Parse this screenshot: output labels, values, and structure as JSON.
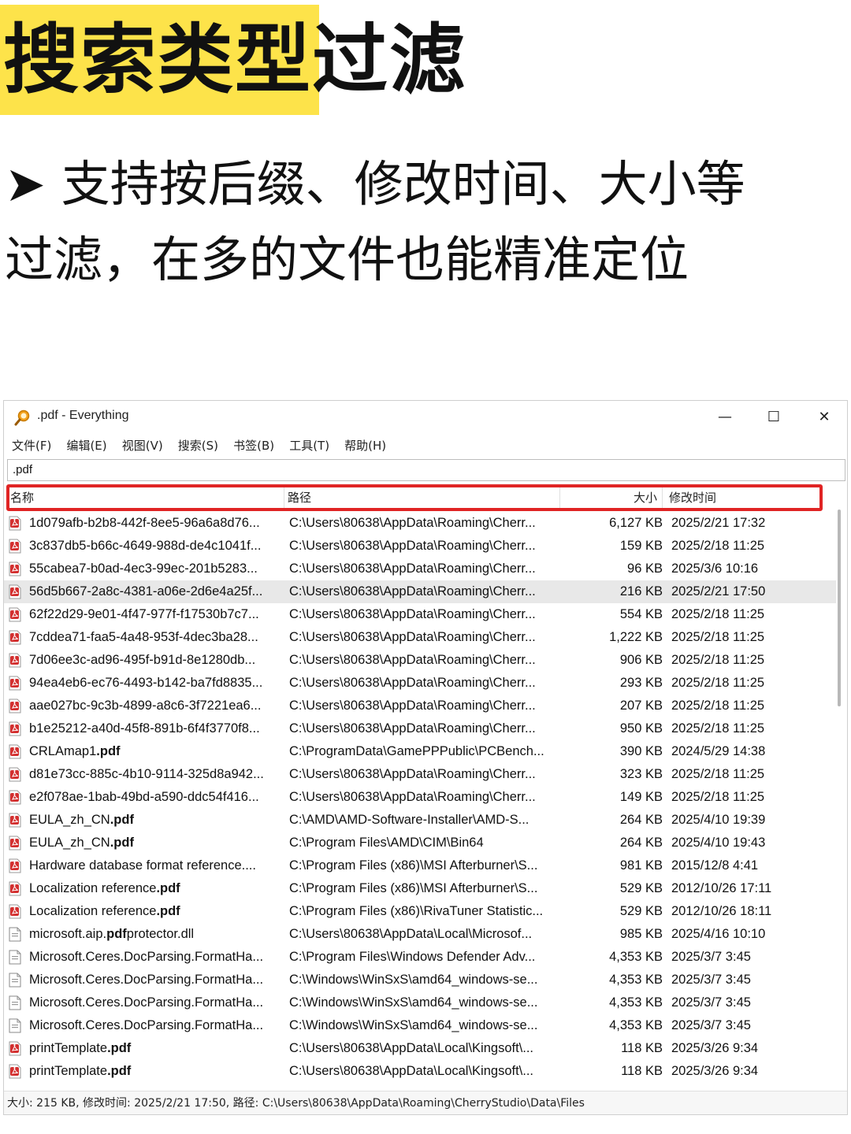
{
  "headline": "搜索类型过滤",
  "subtitle": {
    "bullet": "➤",
    "line1": "支持按后缀、修改时间、大小等",
    "line2": "过滤，在多的文件也能精准定位"
  },
  "colors": {
    "highlight": "#fde34a",
    "red_frame": "#e02424",
    "pdf_icon": "#d32f2f"
  },
  "window": {
    "title": ".pdf - Everything",
    "app_icon": "magnifier-icon",
    "controls": {
      "minimize": "—",
      "maximize": "☐",
      "close": "✕"
    },
    "menu": [
      "文件(F)",
      "编辑(E)",
      "视图(V)",
      "搜索(S)",
      "书签(B)",
      "工具(T)",
      "帮助(H)"
    ],
    "search_value": ".pdf",
    "columns": {
      "name": "名称",
      "path": "路径",
      "size": "大小",
      "modified": "修改时间"
    },
    "rows": [
      {
        "icon": "pdf",
        "name": "1d079afb-b2b8-442f-8ee5-96a6a8d76...",
        "path": "C:\\Users\\80638\\AppData\\Roaming\\Cherr...",
        "size": "6,127 KB",
        "modified": "2025/2/21 17:32"
      },
      {
        "icon": "pdf",
        "name": "3c837db5-b66c-4649-988d-de4c1041f...",
        "path": "C:\\Users\\80638\\AppData\\Roaming\\Cherr...",
        "size": "159 KB",
        "modified": "2025/2/18 11:25"
      },
      {
        "icon": "pdf",
        "name": "55cabea7-b0ad-4ec3-99ec-201b5283...",
        "path": "C:\\Users\\80638\\AppData\\Roaming\\Cherr...",
        "size": "96 KB",
        "modified": "2025/3/6 10:16"
      },
      {
        "icon": "pdf",
        "name": "56d5b667-2a8c-4381-a06e-2d6e4a25f...",
        "path": "C:\\Users\\80638\\AppData\\Roaming\\Cherr...",
        "size": "216 KB",
        "modified": "2025/2/21 17:50",
        "selected": true
      },
      {
        "icon": "pdf",
        "name": "62f22d29-9e01-4f47-977f-f17530b7c7...",
        "path": "C:\\Users\\80638\\AppData\\Roaming\\Cherr...",
        "size": "554 KB",
        "modified": "2025/2/18 11:25"
      },
      {
        "icon": "pdf",
        "name": "7cddea71-faa5-4a48-953f-4dec3ba28...",
        "path": "C:\\Users\\80638\\AppData\\Roaming\\Cherr...",
        "size": "1,222 KB",
        "modified": "2025/2/18 11:25"
      },
      {
        "icon": "pdf",
        "name": "7d06ee3c-ad96-495f-b91d-8e1280db...",
        "path": "C:\\Users\\80638\\AppData\\Roaming\\Cherr...",
        "size": "906 KB",
        "modified": "2025/2/18 11:25"
      },
      {
        "icon": "pdf",
        "name": "94ea4eb6-ec76-4493-b142-ba7fd8835...",
        "path": "C:\\Users\\80638\\AppData\\Roaming\\Cherr...",
        "size": "293 KB",
        "modified": "2025/2/18 11:25"
      },
      {
        "icon": "pdf",
        "name": "aae027bc-9c3b-4899-a8c6-3f7221ea6...",
        "path": "C:\\Users\\80638\\AppData\\Roaming\\Cherr...",
        "size": "207 KB",
        "modified": "2025/2/18 11:25"
      },
      {
        "icon": "pdf",
        "name": "b1e25212-a40d-45f8-891b-6f4f3770f8...",
        "path": "C:\\Users\\80638\\AppData\\Roaming\\Cherr...",
        "size": "950 KB",
        "modified": "2025/2/18 11:25"
      },
      {
        "icon": "pdf",
        "name": "CRLAmap1.pdf",
        "name_plain": "CRLAmap1",
        "name_bold": ".pdf",
        "path": "C:\\ProgramData\\GamePPPublic\\PCBench...",
        "size": "390 KB",
        "modified": "2024/5/29 14:38"
      },
      {
        "icon": "pdf",
        "name": "d81e73cc-885c-4b10-9114-325d8a942...",
        "path": "C:\\Users\\80638\\AppData\\Roaming\\Cherr...",
        "size": "323 KB",
        "modified": "2025/2/18 11:25"
      },
      {
        "icon": "pdf",
        "name": "e2f078ae-1bab-49bd-a590-ddc54f416...",
        "path": "C:\\Users\\80638\\AppData\\Roaming\\Cherr...",
        "size": "149 KB",
        "modified": "2025/2/18 11:25"
      },
      {
        "icon": "pdf",
        "name": "EULA_zh_CN.pdf",
        "name_plain": "EULA_zh_CN",
        "name_bold": ".pdf",
        "path": "C:\\AMD\\AMD-Software-Installer\\AMD-S...",
        "size": "264 KB",
        "modified": "2025/4/10 19:39"
      },
      {
        "icon": "pdf",
        "name": "EULA_zh_CN.pdf",
        "name_plain": "EULA_zh_CN",
        "name_bold": ".pdf",
        "path": "C:\\Program Files\\AMD\\CIM\\Bin64",
        "size": "264 KB",
        "modified": "2025/4/10 19:43"
      },
      {
        "icon": "pdf",
        "name": "Hardware database format reference....",
        "path": "C:\\Program Files (x86)\\MSI Afterburner\\S...",
        "size": "981 KB",
        "modified": "2015/12/8 4:41"
      },
      {
        "icon": "pdf",
        "name": "Localization reference.pdf",
        "name_plain": "Localization reference",
        "name_bold": ".pdf",
        "path": "C:\\Program Files (x86)\\MSI Afterburner\\S...",
        "size": "529 KB",
        "modified": "2012/10/26 17:11"
      },
      {
        "icon": "pdf",
        "name": "Localization reference.pdf",
        "name_plain": "Localization reference",
        "name_bold": ".pdf",
        "path": "C:\\Program Files (x86)\\RivaTuner Statistic...",
        "size": "529 KB",
        "modified": "2012/10/26 18:11"
      },
      {
        "icon": "file",
        "name": "microsoft.aip.pdfprotector.dll",
        "name_plain": "microsoft.aip.",
        "name_bold": "pdf",
        "name_tail": "protector.dll",
        "path": "C:\\Users\\80638\\AppData\\Local\\Microsof...",
        "size": "985 KB",
        "modified": "2025/4/16 10:10"
      },
      {
        "icon": "file",
        "name": "Microsoft.Ceres.DocParsing.FormatHa...",
        "path": "C:\\Program Files\\Windows Defender Adv...",
        "size": "4,353 KB",
        "modified": "2025/3/7 3:45"
      },
      {
        "icon": "file",
        "name": "Microsoft.Ceres.DocParsing.FormatHa...",
        "path": "C:\\Windows\\WinSxS\\amd64_windows-se...",
        "size": "4,353 KB",
        "modified": "2025/3/7 3:45"
      },
      {
        "icon": "file",
        "name": "Microsoft.Ceres.DocParsing.FormatHa...",
        "path": "C:\\Windows\\WinSxS\\amd64_windows-se...",
        "size": "4,353 KB",
        "modified": "2025/3/7 3:45"
      },
      {
        "icon": "file",
        "name": "Microsoft.Ceres.DocParsing.FormatHa...",
        "path": "C:\\Windows\\WinSxS\\amd64_windows-se...",
        "size": "4,353 KB",
        "modified": "2025/3/7 3:45"
      },
      {
        "icon": "pdf",
        "name": "printTemplate.pdf",
        "name_plain": "printTemplate",
        "name_bold": ".pdf",
        "path": "C:\\Users\\80638\\AppData\\Local\\Kingsoft\\...",
        "size": "118 KB",
        "modified": "2025/3/26 9:34"
      },
      {
        "icon": "pdf",
        "name": "printTemplate.pdf",
        "name_plain": "printTemplate",
        "name_bold": ".pdf",
        "path": "C:\\Users\\80638\\AppData\\Local\\Kingsoft\\...",
        "size": "118 KB",
        "modified": "2025/3/26 9:34"
      }
    ],
    "status": "大小: 215 KB, 修改时间: 2025/2/21 17:50, 路径: C:\\Users\\80638\\AppData\\Roaming\\CherryStudio\\Data\\Files"
  }
}
